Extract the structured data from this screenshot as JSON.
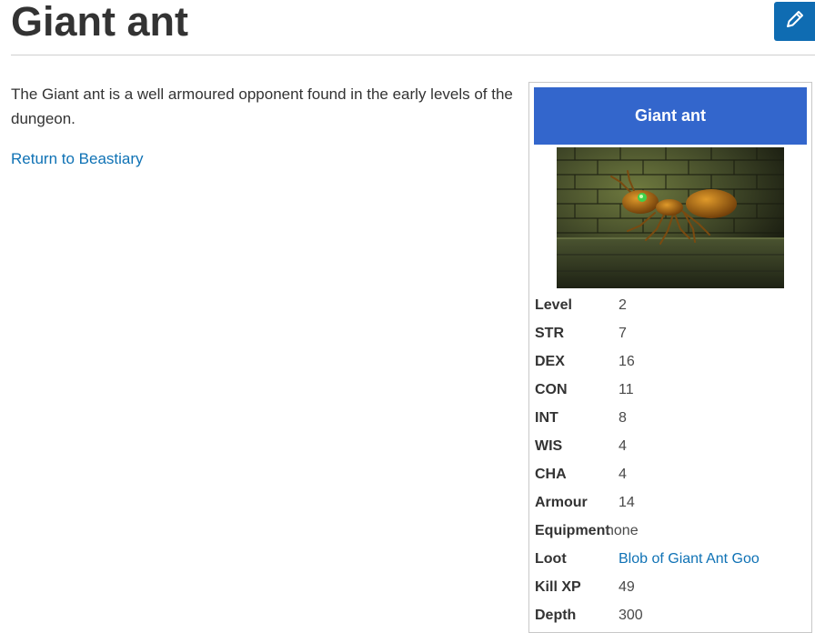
{
  "page": {
    "title": "Giant ant",
    "edit_icon": "pencil-icon",
    "intro": "The Giant ant is a well armoured opponent found in the early levels of the dungeon.",
    "return_link": "Return to Beastiary"
  },
  "infobox": {
    "header": "Giant ant",
    "header_color": "#3366cc",
    "stats": [
      {
        "label": "Level",
        "value": "2"
      },
      {
        "label": "STR",
        "value": "7"
      },
      {
        "label": "DEX",
        "value": "16"
      },
      {
        "label": "CON",
        "value": "11"
      },
      {
        "label": "INT",
        "value": "8"
      },
      {
        "label": "WIS",
        "value": "4"
      },
      {
        "label": "CHA",
        "value": "4"
      },
      {
        "label": "Armour",
        "value": "14"
      },
      {
        "label": "Equipment",
        "value": "none"
      },
      {
        "label": "Loot",
        "value": "Blob of Giant Ant Goo"
      },
      {
        "label": "Kill XP",
        "value": "49"
      },
      {
        "label": "Depth",
        "value": "300"
      }
    ]
  },
  "colors": {
    "link": "#0f72b5",
    "edit_button": "#0f6cb2",
    "text": "#333333"
  }
}
